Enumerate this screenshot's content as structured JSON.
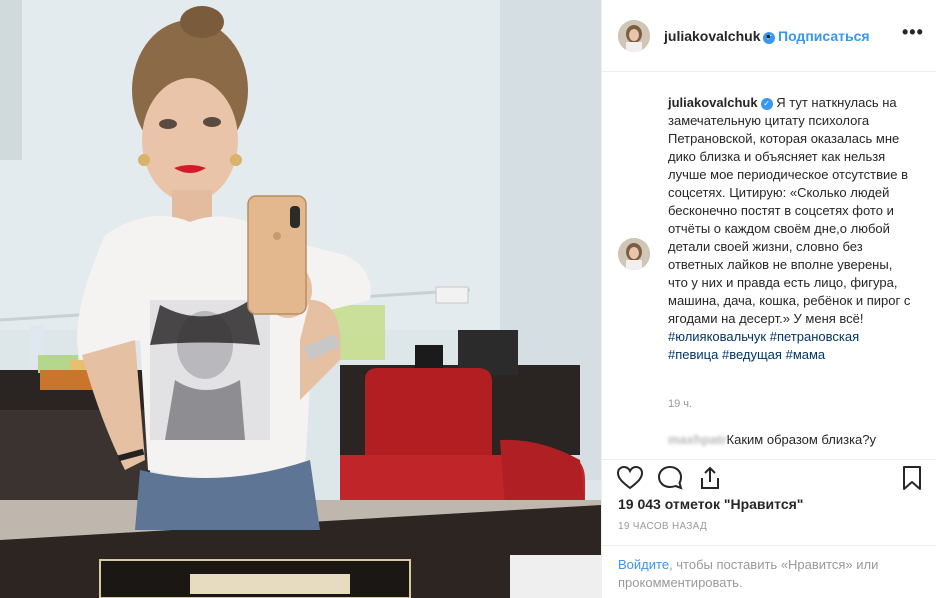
{
  "post": {
    "username": "juliakovalchuk",
    "follow_separator": "•",
    "follow_label": "Подписаться",
    "more_label": "•••"
  },
  "caption": {
    "username": "juliakovalchuk",
    "text": "Я тут наткнулась на замечательную цитату психолога Петрановской, которая оказалась мне дико близка и объясняет как нельзя лучше мое периодическое отсутствие в соцсетях. Цитирую: «Сколько людей бесконечно постят в соцсетях фото и отчёты о каждом своём дне,о любой детали своей жизни, словно без ответных лайков не вполне уверены, что у них и правда есть лицо, фигура, машина, дача, кошка, ребёнок и пирог с ягодами на десерт.» У меня всё!",
    "hashtags": [
      "#юлияковальчук",
      "#петрановская",
      "#певица",
      "#ведущая",
      "#мама"
    ],
    "time": "19 ч."
  },
  "comment": {
    "username": "maxhpatr",
    "text": "Каким образом близка?у"
  },
  "actions": {
    "like": "heart-icon",
    "comment": "comment-icon",
    "share": "share-icon",
    "save": "bookmark-icon"
  },
  "likes_text": "19 043 отметок \"Нравится\"",
  "timestamp": "19 ЧАСОВ НАЗАД",
  "footer": {
    "login_link": "Войдите",
    "login_rest": ", чтобы поставить «Нравится» или прокомментировать."
  },
  "colors": {
    "link_blue": "#3897f0",
    "hashtag": "#003569",
    "muted": "#999999",
    "border": "#efefef"
  }
}
